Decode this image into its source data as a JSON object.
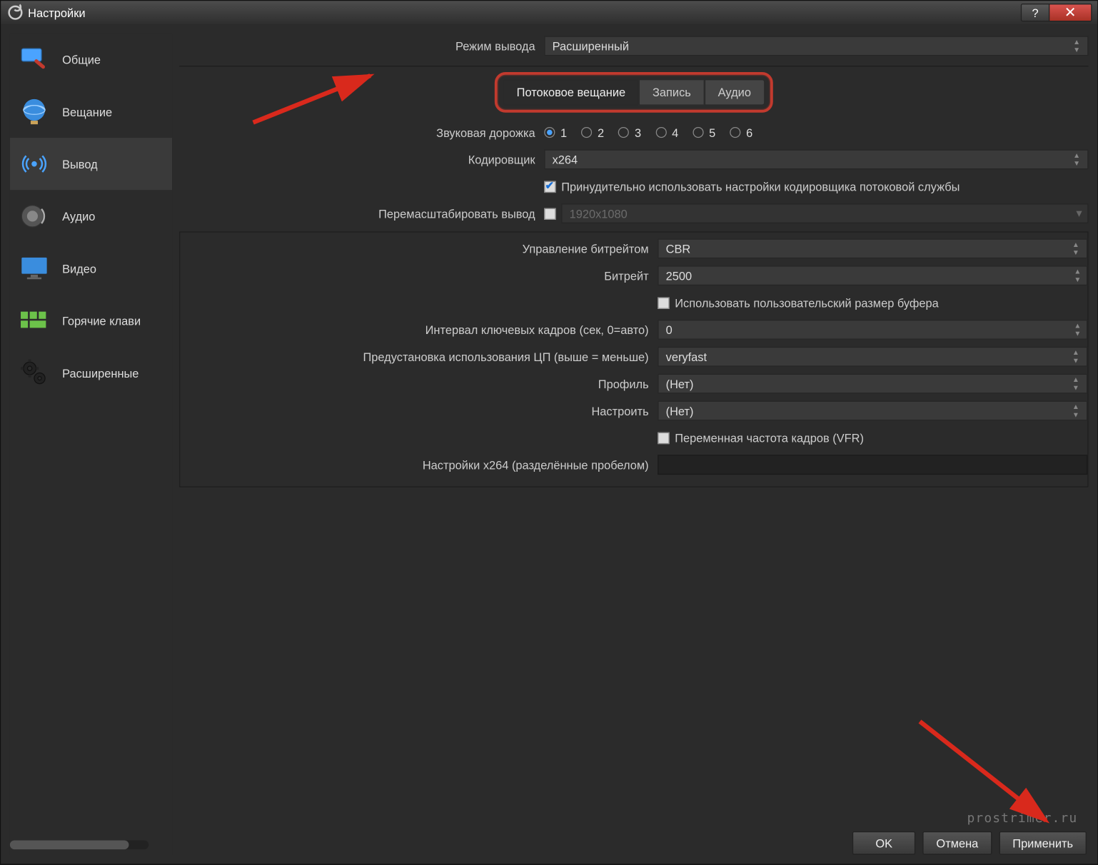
{
  "window": {
    "title": "Настройки"
  },
  "titlebar": {
    "help": "?",
    "close": "✕"
  },
  "sidebar": {
    "items": [
      {
        "label": "Общие"
      },
      {
        "label": "Вещание"
      },
      {
        "label": "Вывод"
      },
      {
        "label": "Аудио"
      },
      {
        "label": "Видео"
      },
      {
        "label": "Горячие клави"
      },
      {
        "label": "Расширенные"
      }
    ],
    "active_index": 2
  },
  "top": {
    "output_mode_label": "Режим вывода",
    "output_mode_value": "Расширенный"
  },
  "tabs": {
    "items": [
      {
        "label": "Потоковое вещание"
      },
      {
        "label": "Запись"
      },
      {
        "label": "Аудио"
      }
    ],
    "active_index": 0
  },
  "fields": {
    "audio_track_label": "Звуковая дорожка",
    "audio_tracks": [
      "1",
      "2",
      "3",
      "4",
      "5",
      "6"
    ],
    "audio_track_selected": 0,
    "encoder_label": "Кодировщик",
    "encoder_value": "x264",
    "enforce_encoder_label": "Принудительно использовать настройки кодировщика потоковой службы",
    "enforce_encoder_checked": true,
    "rescale_label": "Перемасштабировать вывод",
    "rescale_checked": false,
    "rescale_value": "1920x1080",
    "rate_control_label": "Управление битрейтом",
    "rate_control_value": "CBR",
    "bitrate_label": "Битрейт",
    "bitrate_value": "2500",
    "custom_buffer_label": "Использовать пользовательский размер буфера",
    "custom_buffer_checked": false,
    "keyframe_label": "Интервал ключевых кадров (сек, 0=авто)",
    "keyframe_value": "0",
    "cpu_preset_label": "Предустановка использования ЦП (выше = меньше)",
    "cpu_preset_value": "veryfast",
    "profile_label": "Профиль",
    "profile_value": "(Нет)",
    "tune_label": "Настроить",
    "tune_value": "(Нет)",
    "vfr_label": "Переменная частота кадров (VFR)",
    "vfr_checked": false,
    "x264opts_label": "Настройки x264 (разделённые пробелом)",
    "x264opts_value": ""
  },
  "buttons": {
    "ok": "OK",
    "cancel": "Отмена",
    "apply": "Применить"
  },
  "watermark": "prostrimer.ru"
}
